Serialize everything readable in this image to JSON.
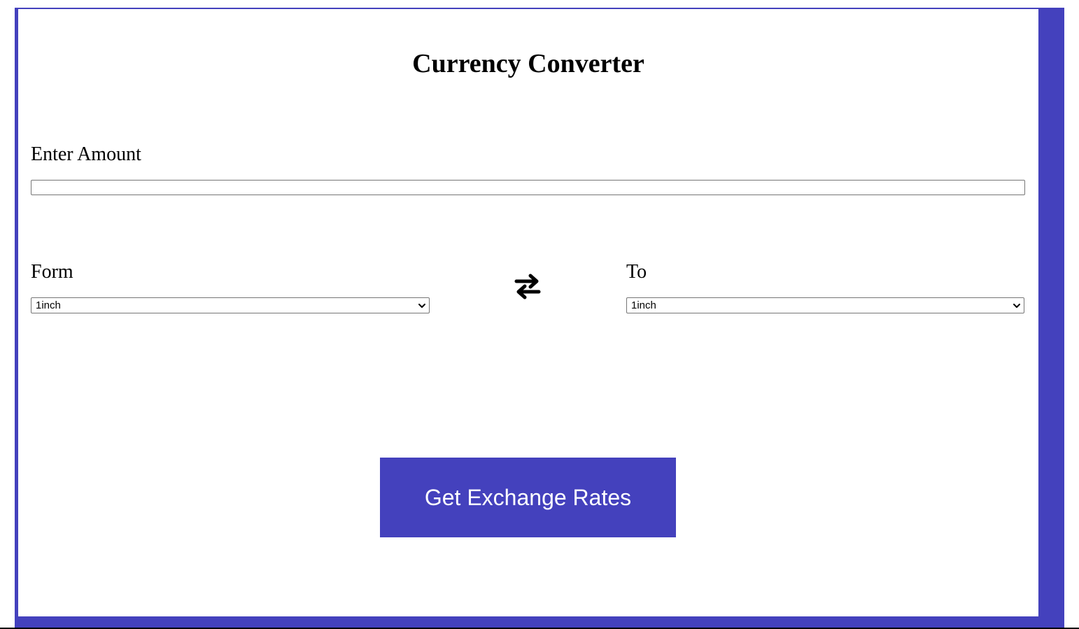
{
  "app": {
    "title": "Currency Converter"
  },
  "amount": {
    "label": "Enter Amount",
    "value": "",
    "placeholder": ""
  },
  "from": {
    "label": "Form",
    "selected": "1inch"
  },
  "to": {
    "label": "To",
    "selected": "1inch"
  },
  "swap": {
    "icon": "swap-arrows-icon"
  },
  "actions": {
    "get_rates_label": "Get Exchange Rates"
  },
  "colors": {
    "accent": "#4441bd",
    "text": "#000000",
    "background": "#ffffff"
  }
}
